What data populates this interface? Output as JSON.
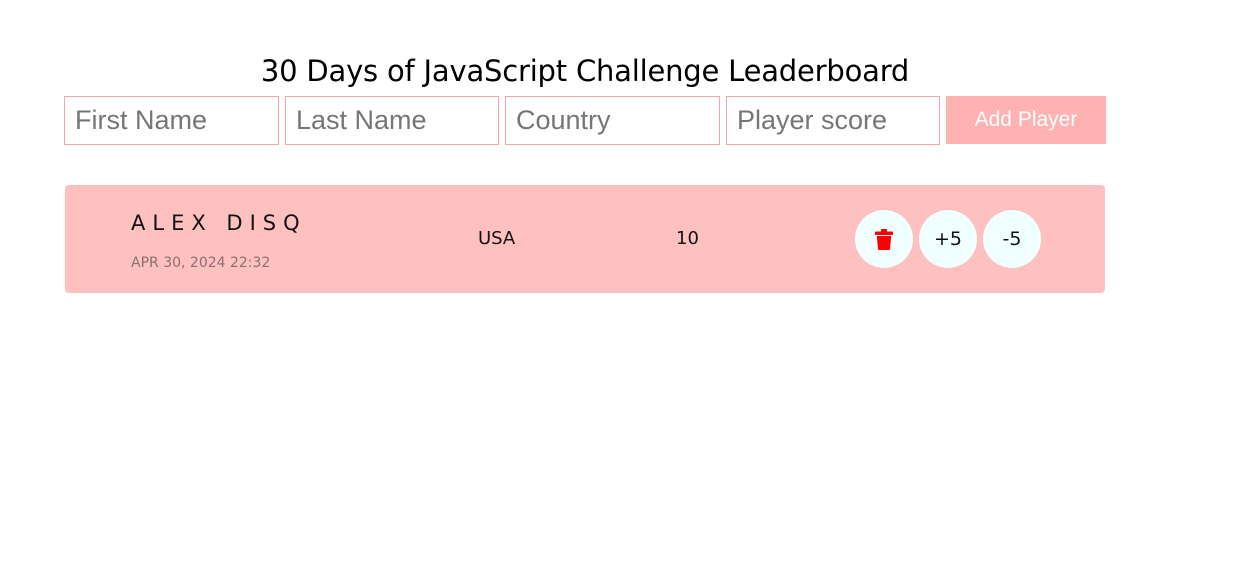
{
  "page": {
    "title": "30 Days of JavaScript Challenge Leaderboard"
  },
  "form": {
    "first_name_placeholder": "First Name",
    "last_name_placeholder": "Last Name",
    "country_placeholder": "Country",
    "score_placeholder": "Player score",
    "add_button_label": "Add Player"
  },
  "players": [
    {
      "name": "ALEX DISQ",
      "date": "APR 30, 2024 22:32",
      "country": "USA",
      "score": "10",
      "delete_icon": "trash-icon",
      "plus_label": "+5",
      "minus_label": "-5"
    }
  ],
  "colors": {
    "card_background": "#ffc0c0",
    "add_button": "#ffb2b2",
    "input_border": "#f3a8a8",
    "round_button": "#f0ffff",
    "trash_icon": "#ff0000"
  }
}
